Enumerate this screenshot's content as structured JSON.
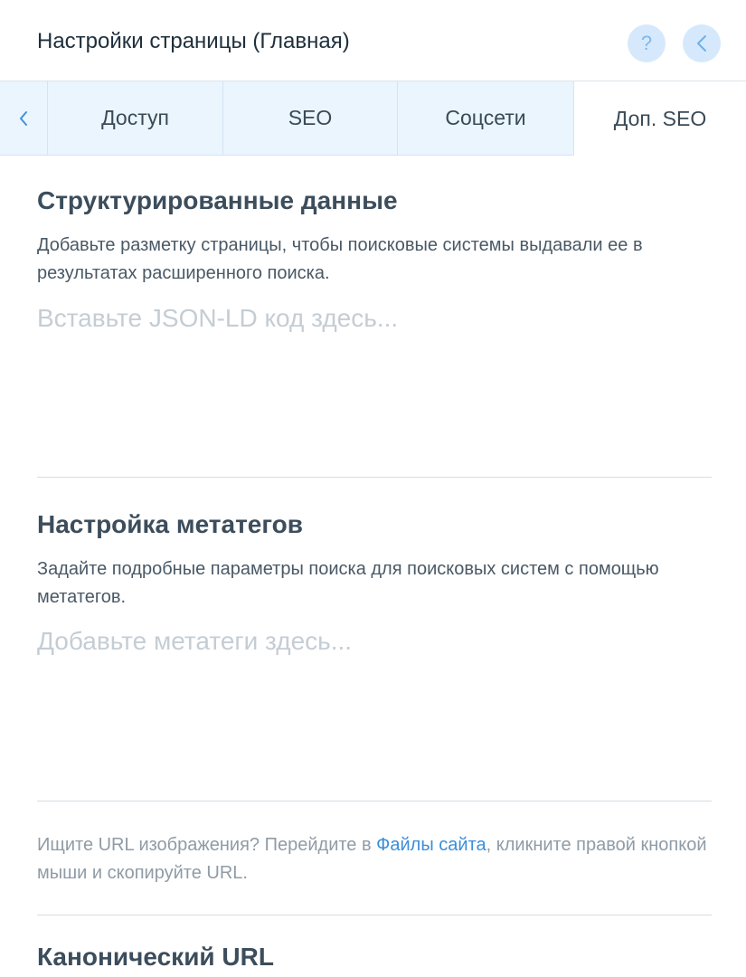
{
  "header": {
    "title": "Настройки страницы (Главная)",
    "help_icon": "question-icon",
    "back_icon": "chevron-left-icon",
    "help_glyph": "?"
  },
  "tabs": {
    "prev_icon": "chevron-left-icon",
    "items": [
      {
        "label": "Доступ"
      },
      {
        "label": "SEO"
      },
      {
        "label": "Соцсети"
      },
      {
        "label": "Доп. SEO"
      }
    ],
    "active": "Доп. SEO"
  },
  "structured": {
    "title": "Структурированные данные",
    "description": "Добавьте разметку страницы, чтобы поисковые системы выдавали ее в результатах расширенного поиска.",
    "placeholder": "Вставьте JSON-LD код здесь...",
    "value": ""
  },
  "meta": {
    "title": "Настройка метатегов",
    "description": "Задайте подробные параметры поиска для поисковых систем с помощью метатегов.",
    "placeholder": "Добавьте метатеги здесь...",
    "value": ""
  },
  "hint": {
    "before": "Ищите URL изображения? Перейдите в ",
    "link": "Файлы сайта",
    "after": ", кликните правой кнопкой мыши и скопируйте URL."
  },
  "canonical": {
    "title": "Канонический URL"
  },
  "colors": {
    "accent": "#3b8ed9",
    "tab_bg": "#eaf5fe",
    "button_bg": "#d6e9fc",
    "heading": "#3c4d5c"
  }
}
